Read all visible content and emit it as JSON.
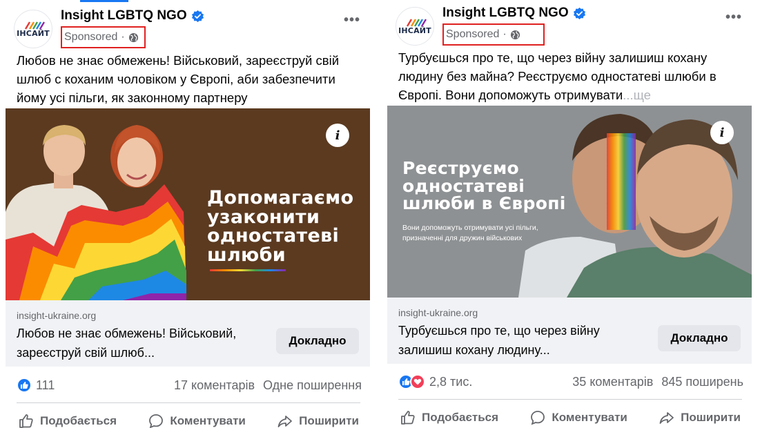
{
  "posts": [
    {
      "page_name": "Insight LGBTQ NGO",
      "logo_text": "ІНСАЙТ",
      "sponsored_label": "Sponsored",
      "separator": "·",
      "caption": "Любов не знає обмежень! Військовий, зареєструй свій шлюб с коханим чоловіком у Європі, аби забезпечити йому усі пільги, як законному партнеру",
      "creative": {
        "headline": [
          "Допомагаємо",
          "узаконити",
          "одностатеві",
          "шлюби"
        ],
        "info_label": "i",
        "background_color": "#5b3a20"
      },
      "link": {
        "domain": "insight-ukraine.org",
        "title": "Любов не знає обмежень! Військовий, зареєструй свій шлюб...",
        "cta_label": "Докладно"
      },
      "reactions": {
        "count": "111",
        "types": [
          "like-icon"
        ]
      },
      "comments": "17 коментарів",
      "shares": "Одне поширення",
      "actions": {
        "like": "Подобається",
        "comment": "Коментувати",
        "share": "Поширити"
      }
    },
    {
      "page_name": "Insight LGBTQ NGO",
      "logo_text": "ІНСАЙТ",
      "sponsored_label": "Sponsored",
      "separator": "·",
      "caption": "Турбуєшься про те, що через війну залишиш кохану людину без майна? Реєструємо одностатеві шлюби в Європі. Вони допоможуть отримувати",
      "caption_more": "...ще",
      "creative": {
        "headline": [
          "Реєструємо",
          "одностатеві",
          "шлюби в Європі"
        ],
        "subtext": "Вони допоможуть отримувати усі пільги, призначенні для дружин військових",
        "info_label": "i",
        "background_color": "#8e9193"
      },
      "link": {
        "domain": "insight-ukraine.org",
        "title": "Турбуєшься про те, що через війну залишиш кохану людину...",
        "cta_label": "Докладно"
      },
      "reactions": {
        "count": "2,8 тис.",
        "types": [
          "like-icon",
          "love-icon"
        ]
      },
      "comments": "35 коментарів",
      "shares": "845 поширень",
      "actions": {
        "like": "Подобається",
        "comment": "Коментувати",
        "share": "Поширити"
      }
    }
  ],
  "colors": {
    "facebook_blue": "#1877f2",
    "sponsor_highlight": "#e02020",
    "secondary_text": "#65676b",
    "link_bar_bg": "#f0f2f5"
  }
}
